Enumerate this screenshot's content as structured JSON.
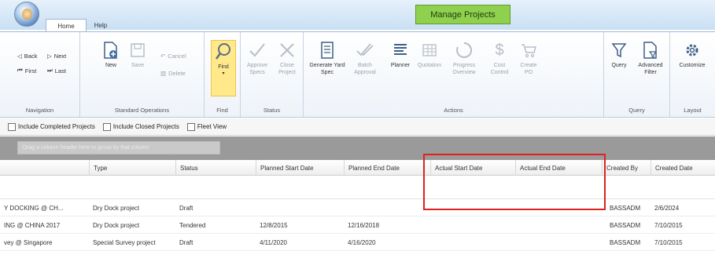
{
  "window": {
    "title": "Manage Projects"
  },
  "tabs": [
    {
      "label": "Home"
    },
    {
      "label": "Help"
    }
  ],
  "ribbon": {
    "navigation": {
      "label": "Navigation",
      "items": [
        {
          "label": "Back",
          "icon": "back-icon"
        },
        {
          "label": "Next",
          "icon": "next-icon"
        },
        {
          "label": "First",
          "icon": "first-icon"
        },
        {
          "label": "Last",
          "icon": "last-icon"
        }
      ]
    },
    "standard": {
      "label": "Standard Operations",
      "new": "New",
      "save": "Save",
      "cancel": "Cancel",
      "delete": "Delete"
    },
    "find": {
      "label": "Find",
      "button": "Find"
    },
    "status": {
      "label": "Status",
      "approve": "Approve Specs",
      "close": "Close Project"
    },
    "actions": {
      "label": "Actions",
      "generate": "Generate Yard Spec",
      "batch": "Batch Approval",
      "planner": "Planner",
      "quotation": "Quotation",
      "progress": "Progress Overview",
      "cost": "Cost Control",
      "create_po": "Create PO"
    },
    "query": {
      "label": "Query",
      "query": "Query",
      "advanced": "Advanced Filter"
    },
    "layout": {
      "label": "Layout",
      "customize": "Customize"
    }
  },
  "options": {
    "include_completed": "Include Completed Projects",
    "include_closed": "Include Closed Projects",
    "fleet_view": "Fleet View"
  },
  "groupby_hint": "Drag a column header here to group by that column",
  "columns": [
    "Type",
    "Status",
    "Planned Start Date",
    "Planned End Date",
    "Actual Start Date",
    "Actual End Date",
    "Created By",
    "Created Date"
  ],
  "rows": [
    {
      "name": "Y DOCKING @ CH...",
      "type": "Dry Dock project",
      "status": "Draft",
      "pstart": "",
      "pend": "",
      "astart": "",
      "aend": "",
      "by": "BASSADM",
      "date": "2/6/2024"
    },
    {
      "name": "ING @ CHINA 2017",
      "type": "Dry Dock project",
      "status": "Tendered",
      "pstart": "12/8/2015",
      "pend": "12/16/2018",
      "astart": "",
      "aend": "",
      "by": "BASSADM",
      "date": "7/10/2015"
    },
    {
      "name": "vey @ Singapore",
      "type": "Special Survey project",
      "status": "Draft",
      "pstart": "4/11/2020",
      "pend": "4/16/2020",
      "astart": "",
      "aend": "",
      "by": "BASSADM",
      "date": "7/10/2015"
    }
  ]
}
